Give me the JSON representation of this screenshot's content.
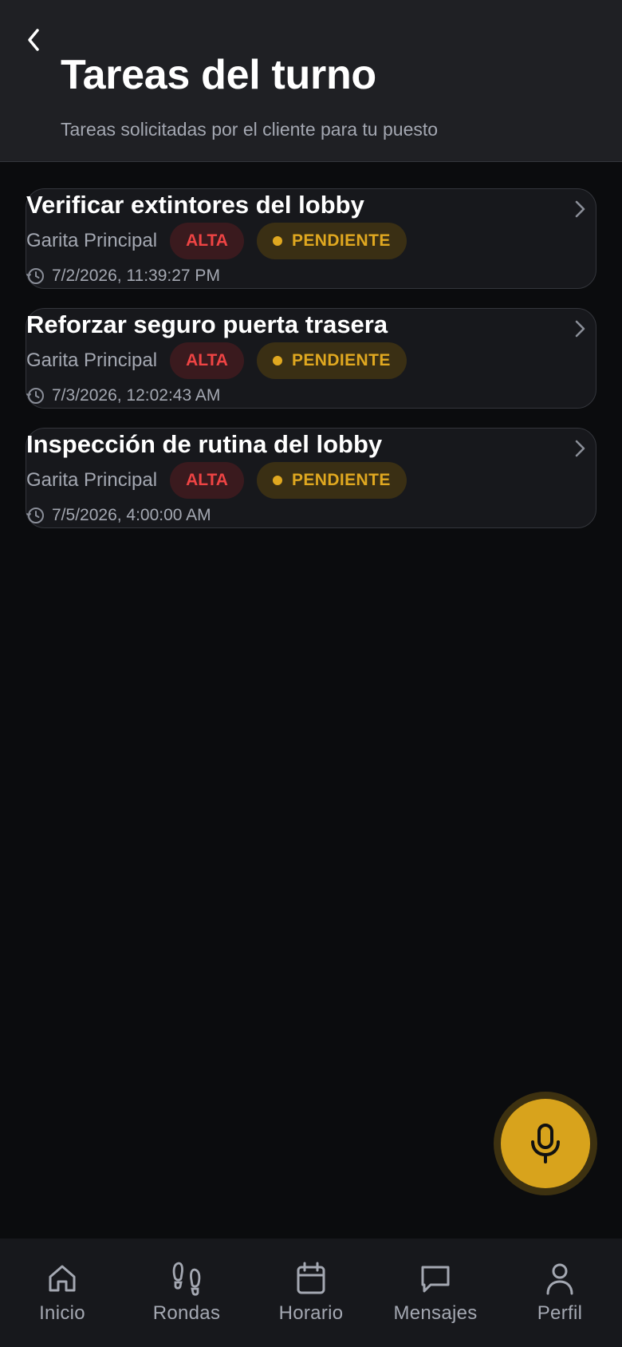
{
  "header": {
    "title": "Tareas del turno",
    "subtitle": "Tareas solicitadas por el cliente para tu puesto",
    "back_icon": "chevron-left-icon"
  },
  "tasks": [
    {
      "title": "Verificar extintores del lobby",
      "location": "Garita Principal",
      "priority": "ALTA",
      "status": "PENDIENTE",
      "datetime": "7/2/2026, 11:39:27 PM"
    },
    {
      "title": "Reforzar seguro puerta trasera",
      "location": "Garita Principal",
      "priority": "ALTA",
      "status": "PENDIENTE",
      "datetime": "7/3/2026, 12:02:43 AM"
    },
    {
      "title": "Inspección de rutina del lobby",
      "location": "Garita Principal",
      "priority": "ALTA",
      "status": "PENDIENTE",
      "datetime": "7/5/2026, 4:00:00 AM"
    }
  ],
  "fab": {
    "icon": "microphone-icon"
  },
  "bottom_nav": [
    {
      "label": "Inicio",
      "icon": "home-icon"
    },
    {
      "label": "Rondas",
      "icon": "footprints-icon"
    },
    {
      "label": "Horario",
      "icon": "calendar-icon"
    },
    {
      "label": "Mensajes",
      "icon": "message-icon"
    },
    {
      "label": "Perfil",
      "icon": "user-icon"
    }
  ],
  "colors": {
    "accent": "#d8a31c",
    "priority_high": "#ef4444",
    "status_pending": "#e0a820",
    "background": "#0b0c0e",
    "header_bg": "#1f2024"
  }
}
